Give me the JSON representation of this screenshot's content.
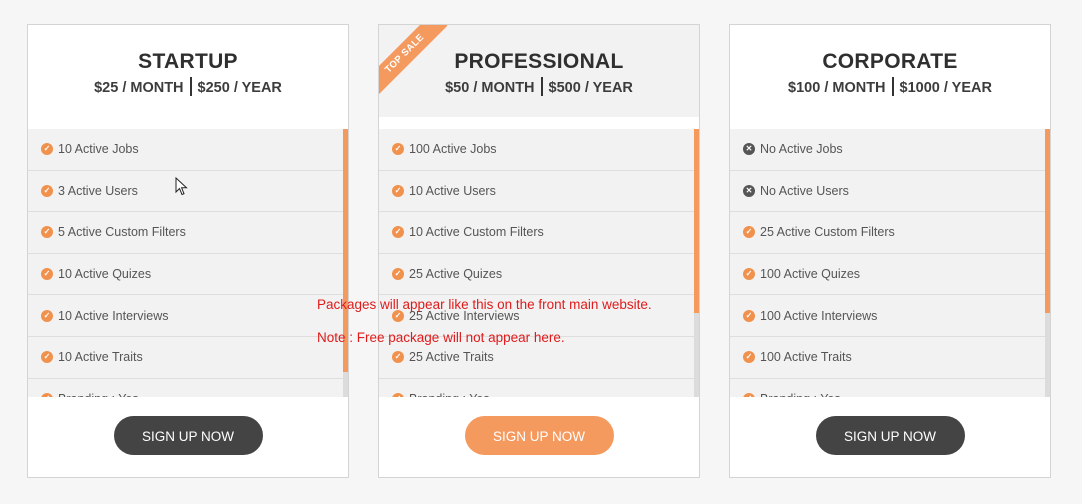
{
  "plans": [
    {
      "title": "STARTUP",
      "monthly": "$25 / MONTH",
      "yearly": "$250 / YEAR",
      "featured": false,
      "button_label": "SIGN UP NOW",
      "features": [
        {
          "label": "10 Active Jobs",
          "icon": "check-icon"
        },
        {
          "label": "3 Active Users",
          "icon": "check-icon"
        },
        {
          "label": "5 Active Custom Filters",
          "icon": "check-icon"
        },
        {
          "label": "10 Active Quizes",
          "icon": "check-icon"
        },
        {
          "label": "10 Active Interviews",
          "icon": "check-icon"
        },
        {
          "label": "10 Active Traits",
          "icon": "check-icon"
        },
        {
          "label": "Branding : Yes",
          "icon": "check-icon"
        }
      ],
      "scroll_fraction": 0.9
    },
    {
      "title": "PROFESSIONAL",
      "monthly": "$50 / MONTH",
      "yearly": "$500 / YEAR",
      "featured": true,
      "ribbon": "TOP SALE",
      "button_label": "SIGN UP NOW",
      "features": [
        {
          "label": "100 Active Jobs",
          "icon": "check-icon"
        },
        {
          "label": "10 Active Users",
          "icon": "check-icon"
        },
        {
          "label": "10 Active Custom Filters",
          "icon": "check-icon"
        },
        {
          "label": "25 Active Quizes",
          "icon": "check-icon"
        },
        {
          "label": "25 Active Interviews",
          "icon": "check-icon"
        },
        {
          "label": "25 Active Traits",
          "icon": "check-icon"
        },
        {
          "label": "Branding : Yes",
          "icon": "check-icon"
        }
      ],
      "scroll_fraction": 0.68
    },
    {
      "title": "CORPORATE",
      "monthly": "$100 / MONTH",
      "yearly": "$1000 / YEAR",
      "featured": false,
      "button_label": "SIGN UP NOW",
      "features": [
        {
          "label": "No Active Jobs",
          "icon": "cross-icon"
        },
        {
          "label": "No Active Users",
          "icon": "cross-icon"
        },
        {
          "label": "25 Active Custom Filters",
          "icon": "check-icon"
        },
        {
          "label": "100 Active Quizes",
          "icon": "check-icon"
        },
        {
          "label": "100 Active Interviews",
          "icon": "check-icon"
        },
        {
          "label": "100 Active Traits",
          "icon": "check-icon"
        },
        {
          "label": "Branding : Yes",
          "icon": "check-icon"
        }
      ],
      "scroll_fraction": 0.68
    }
  ],
  "annotations": [
    "Packages will appear like this on the front main website.",
    "Note : Free package will not appear here."
  ],
  "colors": {
    "accent": "#f59a5f",
    "check": "#f0924d",
    "dark_button": "#444444",
    "annotation": "#e01b1b"
  }
}
